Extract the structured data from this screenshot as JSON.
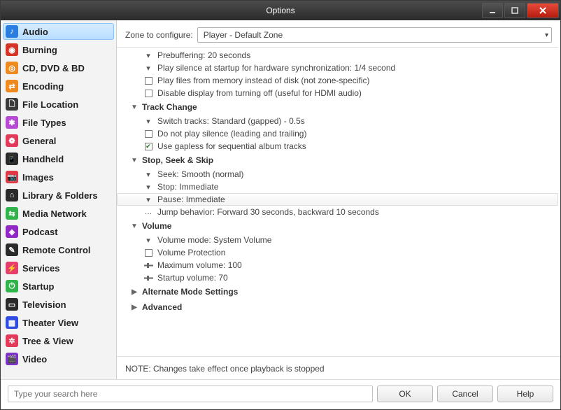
{
  "window": {
    "title": "Options"
  },
  "zone": {
    "label": "Zone to configure:",
    "selected": "Player - Default Zone"
  },
  "sidebar": {
    "items": [
      {
        "label": "Audio",
        "color": "#2a7de1",
        "glyph": "♪",
        "selected": true
      },
      {
        "label": "Burning",
        "color": "#d53528",
        "glyph": "◉"
      },
      {
        "label": "CD, DVD & BD",
        "color": "#f08a1e",
        "glyph": "◎"
      },
      {
        "label": "Encoding",
        "color": "#f08a1e",
        "glyph": "⇄"
      },
      {
        "label": "File Location",
        "color": "#3a3a3a",
        "glyph": "🗋"
      },
      {
        "label": "File Types",
        "color": "#b64ad2",
        "glyph": "✱"
      },
      {
        "label": "General",
        "color": "#e23b5a",
        "glyph": "❁"
      },
      {
        "label": "Handheld",
        "color": "#2b2b2b",
        "glyph": "📱"
      },
      {
        "label": "Images",
        "color": "#e33745",
        "glyph": "📷"
      },
      {
        "label": "Library & Folders",
        "color": "#2b2b2b",
        "glyph": "⌂"
      },
      {
        "label": "Media Network",
        "color": "#2fb34a",
        "glyph": "⇆"
      },
      {
        "label": "Podcast",
        "color": "#9127c5",
        "glyph": "◈"
      },
      {
        "label": "Remote Control",
        "color": "#2b2b2b",
        "glyph": "✎"
      },
      {
        "label": "Services",
        "color": "#e63e6c",
        "glyph": "⚡"
      },
      {
        "label": "Startup",
        "color": "#2fb34a",
        "glyph": "⏻"
      },
      {
        "label": "Television",
        "color": "#2b2b2b",
        "glyph": "▭"
      },
      {
        "label": "Theater View",
        "color": "#2f4de0",
        "glyph": "▦"
      },
      {
        "label": "Tree & View",
        "color": "#e23b5a",
        "glyph": "✲"
      },
      {
        "label": "Video",
        "color": "#7d33c8",
        "glyph": "🎬"
      }
    ]
  },
  "groups": [
    {
      "title": "",
      "collapsed": false,
      "hidden_header": true,
      "items": [
        {
          "kind": "dropdown",
          "label": "Prebuffering: 20 seconds"
        },
        {
          "kind": "dropdown",
          "label": "Play silence at startup for hardware synchronization: 1/4 second"
        },
        {
          "kind": "checkbox",
          "checked": false,
          "label": "Play files from memory instead of disk (not zone-specific)"
        },
        {
          "kind": "checkbox",
          "checked": false,
          "label": "Disable display from turning off (useful for HDMI audio)"
        }
      ]
    },
    {
      "title": "Track Change",
      "collapsed": false,
      "items": [
        {
          "kind": "dropdown",
          "label": "Switch tracks: Standard (gapped) - 0.5s"
        },
        {
          "kind": "checkbox",
          "checked": false,
          "label": "Do not play silence (leading and trailing)"
        },
        {
          "kind": "checkbox",
          "checked": true,
          "label": "Use gapless for sequential album tracks"
        }
      ]
    },
    {
      "title": "Stop, Seek & Skip",
      "collapsed": false,
      "items": [
        {
          "kind": "dropdown",
          "label": "Seek: Smooth (normal)"
        },
        {
          "kind": "dropdown",
          "label": "Stop: Immediate"
        },
        {
          "kind": "dropdown",
          "label": "Pause: Immediate",
          "highlight": true
        },
        {
          "kind": "more",
          "label": "Jump behavior: Forward 30 seconds, backward 10 seconds"
        }
      ]
    },
    {
      "title": "Volume",
      "collapsed": false,
      "items": [
        {
          "kind": "dropdown",
          "label": "Volume mode: System Volume"
        },
        {
          "kind": "checkbox",
          "checked": false,
          "label": "Volume Protection"
        },
        {
          "kind": "slider",
          "label": "Maximum volume: 100"
        },
        {
          "kind": "slider",
          "label": "Startup volume: 70"
        }
      ]
    },
    {
      "title": "Alternate Mode Settings",
      "collapsed": true,
      "items": []
    },
    {
      "title": "Advanced",
      "collapsed": true,
      "items": []
    }
  ],
  "note": "NOTE: Changes take effect once playback is stopped",
  "footer": {
    "search_placeholder": "Type your search here",
    "ok": "OK",
    "cancel": "Cancel",
    "help": "Help"
  }
}
